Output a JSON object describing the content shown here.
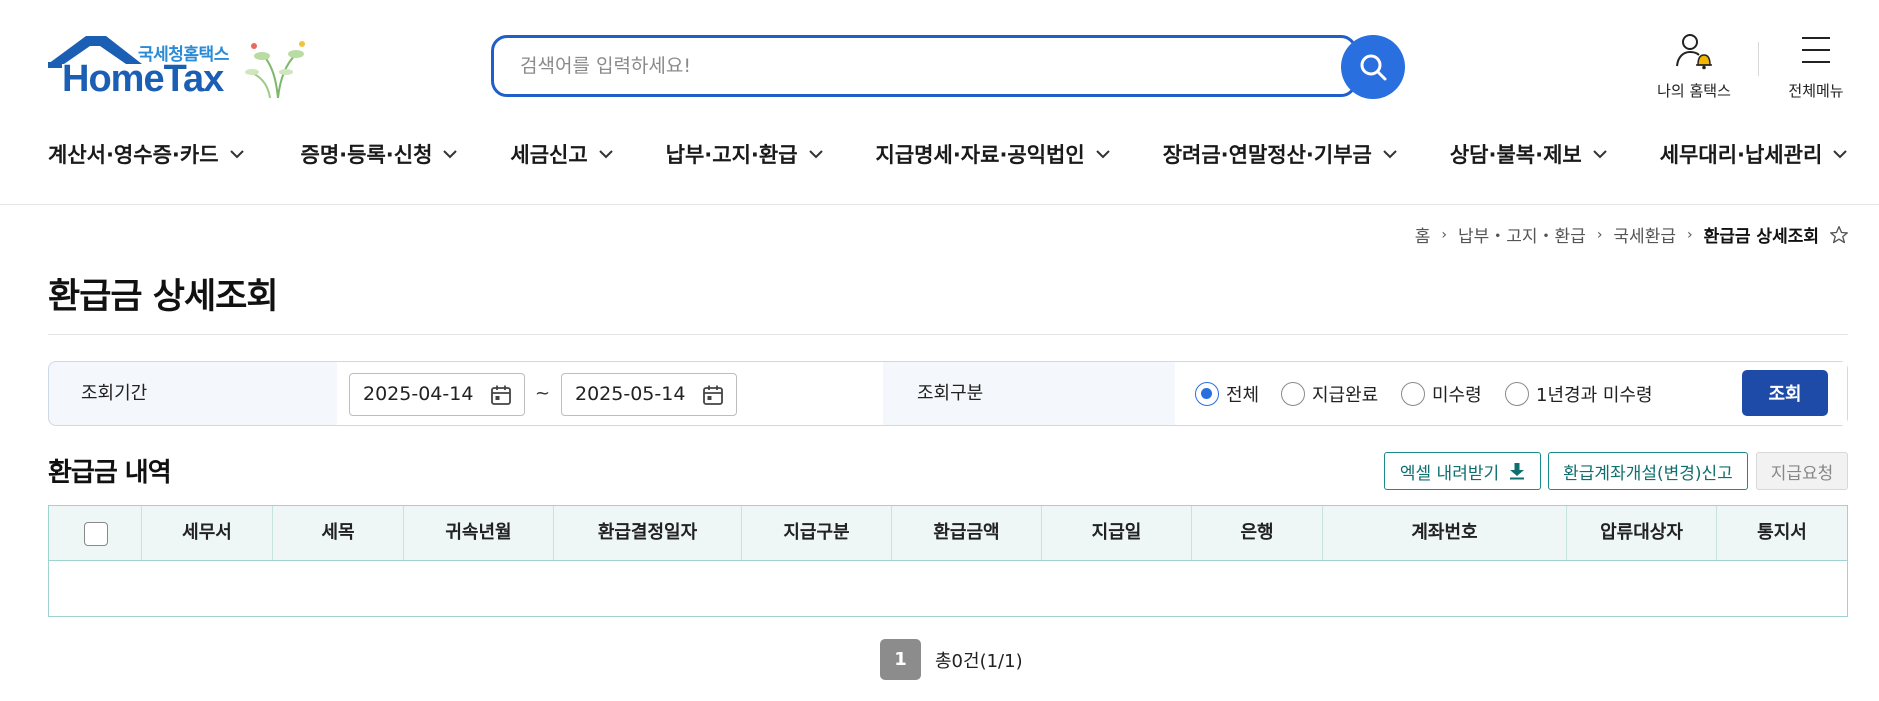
{
  "header": {
    "logo_top": "국세청홈택스",
    "logo_main": "HomeTax",
    "search_placeholder": "검색어를 입력하세요!",
    "my_hometax": "나의 홈택스",
    "full_menu": "전체메뉴"
  },
  "gnb": [
    {
      "label": "계산서·영수증·카드"
    },
    {
      "label": "증명·등록·신청"
    },
    {
      "label": "세금신고"
    },
    {
      "label": "납부·고지·환급"
    },
    {
      "label": "지급명세·자료·공익법인"
    },
    {
      "label": "장려금·연말정산·기부금"
    },
    {
      "label": "상담·불복·제보"
    },
    {
      "label": "세무대리·납세관리"
    }
  ],
  "breadcrumb": {
    "home": "홈",
    "level1": "납부・고지・환급",
    "level2": "국세환급",
    "current": "환급금 상세조회"
  },
  "page_title": "환급금 상세조회",
  "condition": {
    "period_label": "조회기간",
    "date_from": "2025-04-14",
    "tilde": "~",
    "date_to": "2025-05-14",
    "type_label": "조회구분",
    "radios": [
      "전체",
      "지급완료",
      "미수령",
      "1년경과 미수령"
    ],
    "selected_radio": "전체",
    "query_button": "조회"
  },
  "section": {
    "title": "환급금 내역",
    "excel_button": "엑셀 내려받기",
    "account_button": "환급계좌개설(변경)신고",
    "request_button": "지급요청"
  },
  "table": {
    "columns": [
      "세무서",
      "세목",
      "귀속년월",
      "환급결정일자",
      "지급구분",
      "환급금액",
      "지급일",
      "은행",
      "계좌번호",
      "압류대상자",
      "통지서"
    ],
    "rows": []
  },
  "pagination": {
    "current_page": "1",
    "total_text": "총0건(1/1)"
  },
  "colors": {
    "primary_blue": "#2a6fe0",
    "navy_button": "#1e4ba8",
    "teal_border": "#1a8a8a",
    "table_header_bg": "#eef7f6"
  }
}
